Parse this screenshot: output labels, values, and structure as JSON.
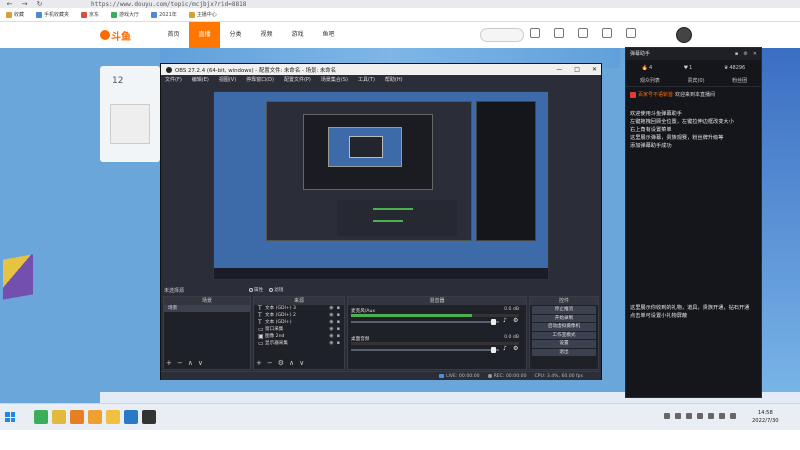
{
  "browser": {
    "url": "https://www.douyu.com/topic/mcjbjx?rid=8818",
    "bookmarks": [
      "收藏",
      "手机收藏夹",
      "京东",
      "游戏大厅",
      "2021年",
      "主播中心"
    ]
  },
  "site": {
    "logo": "斗鱼",
    "nav": [
      "首页",
      "直播",
      "分类",
      "视频",
      "游戏",
      "鱼吧"
    ],
    "room_number": "12"
  },
  "obs": {
    "title": "OBS 27.2.4 (64-bit, windows) - 配置文件: 未命名 - 场景: 未命名",
    "menu": [
      "文件(F)",
      "编辑(E)",
      "视图(V)",
      "停靠窗口(D)",
      "配置文件(P)",
      "场景集合(S)",
      "工具(T)",
      "帮助(H)"
    ],
    "window_buttons": [
      "—",
      "□",
      "✕"
    ],
    "scene_tabs": [
      "属性",
      "滤镜"
    ],
    "docks": {
      "scenes_label": "未选择源",
      "scenes_header": "场景",
      "scenes": [
        "场景"
      ],
      "sources_header": "来源",
      "sources": [
        {
          "icon": "T",
          "name": "文本 (GDI+) 3"
        },
        {
          "icon": "T",
          "name": "文本 (GDI+) 2"
        },
        {
          "icon": "T",
          "name": "文本 (GDI+)"
        },
        {
          "icon": "▭",
          "name": "窗口采集"
        },
        {
          "icon": "▣",
          "name": "图像 2nd"
        },
        {
          "icon": "▭",
          "name": "显示器采集"
        }
      ],
      "mixer_header": "混音器",
      "mixer": [
        {
          "name": "麦克风/Aux",
          "db": "0.0 dB",
          "level": 0.72
        },
        {
          "name": "桌面音频",
          "db": "0.0 dB",
          "level": 0.0
        }
      ],
      "controls_header": "控件",
      "controls": [
        "停止推流",
        "开始录制",
        "启动虚拟摄像机",
        "工作室模式",
        "设置",
        "退出"
      ]
    },
    "status": {
      "live": "LIVE: 00:00:00",
      "rec": "REC: 00:00:00",
      "cpu": "CPU: 3.4%, 60.00 fps"
    }
  },
  "chat": {
    "title": "弹幕助手",
    "stats": [
      {
        "icon": "🔥",
        "value": "4"
      },
      {
        "icon": "♥",
        "value": "1"
      },
      {
        "icon": "♛",
        "value": "48296"
      }
    ],
    "tabs": [
      "观众列表",
      "贵宾(0)",
      "粉丝团"
    ],
    "welcome": {
      "user": "百家号不语斩首",
      "text": "欢迎来到本直播间"
    },
    "messages_top": [
      "欢迎使用斗鱼弹幕助手",
      "左键拖拽回顾全位置，左键拉伸边框改变大小",
      "右上角有设置菜单",
      "这里展示弹幕，贵族观赛，粉丝牌升级等",
      "添加弹幕助手成功"
    ],
    "messages_bottom": [
      "这里展示你收到的礼物，道具，贵族开通，钻石开通",
      "点击单可设置小礼物屏蔽"
    ]
  },
  "taskbar": {
    "time": "14:58",
    "date": "2022/7/30"
  }
}
